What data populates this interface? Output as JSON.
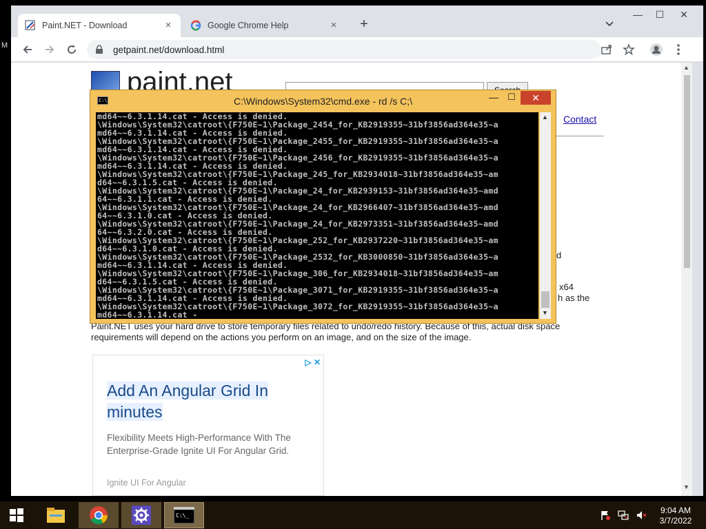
{
  "desktop": {
    "edge_text": "M"
  },
  "browser": {
    "tabs": [
      {
        "title": "Paint.NET - Download"
      },
      {
        "title": "Google Chrome Help"
      }
    ],
    "new_tab_label": "+",
    "url": "getpaint.net/download.html",
    "controls": {
      "minimize": "—",
      "maximize": "☐",
      "close": "✕",
      "tab_close": "×"
    }
  },
  "page": {
    "logo_text": "paint.net",
    "search_button": "Search",
    "contact_link": "Contact",
    "fragments": [
      "d",
      "x64",
      "h as the"
    ],
    "disk_paragraph": "Paint.NET uses your hard drive to store temporary files related to undo/redo history. Because of this, actual disk space requirements will depend on the actions you perform on an image, and on the size of the image.",
    "ad": {
      "badge": "▷ ✕",
      "title": "Add An Angular Grid In minutes",
      "body": "Flexibility Meets High-Performance With The Enterprise-Grade Ignite UI For Angular Grid.",
      "footer": "Ignite UI For Angular"
    }
  },
  "cmd": {
    "icon_text": "C:\\",
    "title": "C:\\Windows\\System32\\cmd.exe - rd  /s C;\\",
    "buttons": {
      "minimize": "—",
      "maximize": "☐",
      "close": "✕"
    },
    "lines": [
      "md64~~6.3.1.14.cat - Access is denied.",
      "\\Windows\\System32\\catroot\\{F750E~1\\Package_2454_for_KB2919355~31bf3856ad364e35~a",
      "md64~~6.3.1.14.cat - Access is denied.",
      "\\Windows\\System32\\catroot\\{F750E~1\\Package_2455_for_KB2919355~31bf3856ad364e35~a",
      "md64~~6.3.1.14.cat - Access is denied.",
      "\\Windows\\System32\\catroot\\{F750E~1\\Package_2456_for_KB2919355~31bf3856ad364e35~a",
      "md64~~6.3.1.14.cat - Access is denied.",
      "\\Windows\\System32\\catroot\\{F750E~1\\Package_245_for_KB2934018~31bf3856ad364e35~am",
      "d64~~6.3.1.5.cat - Access is denied.",
      "\\Windows\\System32\\catroot\\{F750E~1\\Package_24_for_KB2939153~31bf3856ad364e35~amd",
      "64~~6.3.1.1.cat - Access is denied.",
      "\\Windows\\System32\\catroot\\{F750E~1\\Package_24_for_KB2966407~31bf3856ad364e35~amd",
      "64~~6.3.1.0.cat - Access is denied.",
      "\\Windows\\System32\\catroot\\{F750E~1\\Package_24_for_KB2973351~31bf3856ad364e35~amd",
      "64~~6.3.2.0.cat - Access is denied.",
      "\\Windows\\System32\\catroot\\{F750E~1\\Package_252_for_KB2937220~31bf3856ad364e35~am",
      "d64~~6.3.1.0.cat - Access is denied.",
      "\\Windows\\System32\\catroot\\{F750E~1\\Package_2532_for_KB3000850~31bf3856ad364e35~a",
      "md64~~6.3.1.14.cat - Access is denied.",
      "\\Windows\\System32\\catroot\\{F750E~1\\Package_306_for_KB2934018~31bf3856ad364e35~am",
      "d64~~6.3.1.5.cat - Access is denied.",
      "\\Windows\\System32\\catroot\\{F750E~1\\Package_3071_for_KB2919355~31bf3856ad364e35~a",
      "md64~~6.3.1.14.cat - Access is denied.",
      "\\Windows\\System32\\catroot\\{F750E~1\\Package_3072_for_KB2919355~31bf3856ad364e35~a",
      "md64~~6.3.1.14.cat -"
    ]
  },
  "taskbar": {
    "clock_time": "9:04 AM",
    "clock_date": "3/7/2022",
    "cmd_icon_text": "C:\\_"
  },
  "colors": {
    "cmd_frame": "#f4c35c",
    "cmd_close": "#c9432b",
    "taskbar": "#1b1308",
    "link": "#1a0dab"
  }
}
